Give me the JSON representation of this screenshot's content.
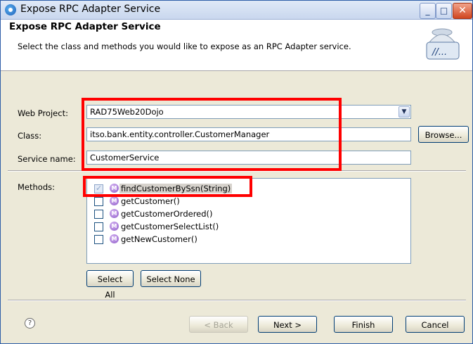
{
  "window": {
    "title": "Expose RPC Adapter Service",
    "minimize_label": "_",
    "maximize_label": "□",
    "close_label": "✕"
  },
  "banner": {
    "title": "Expose RPC Adapter Service",
    "description": "Select the class and methods you would like to expose as an RPC Adapter service.",
    "art_text": "//..."
  },
  "form": {
    "web_project_label": "Web Project:",
    "web_project_value": "RAD75Web20Dojo",
    "class_label": "Class:",
    "class_value": "itso.bank.entity.controller.CustomerManager",
    "browse_label": "Browse...",
    "service_name_label": "Service name:",
    "service_name_value": "CustomerService",
    "methods_label": "Methods:"
  },
  "methods": [
    {
      "name": "findCustomerBySsn(String)",
      "checked": true,
      "selected": true
    },
    {
      "name": "getCustomer()",
      "checked": false,
      "selected": false
    },
    {
      "name": "getCustomerOrdered()",
      "checked": false,
      "selected": false
    },
    {
      "name": "getCustomerSelectList()",
      "checked": false,
      "selected": false
    },
    {
      "name": "getNewCustomer()",
      "checked": false,
      "selected": false
    }
  ],
  "method_icon_letter": "M",
  "method_buttons": {
    "select_all": "Select All",
    "select_none": "Select None"
  },
  "footer": {
    "help_label": "?",
    "back_label": "< Back",
    "next_label": "Next >",
    "finish_label": "Finish",
    "cancel_label": "Cancel"
  },
  "colors": {
    "highlight_box": "#ff0000",
    "titlebar": "#c9d7ee",
    "dialog_bg": "#ece9d8"
  },
  "icons": {
    "title": "rpc-service-icon",
    "banner": "service-bell-icon",
    "method": "method-icon",
    "help": "help-icon",
    "combo": "chevron-down-icon"
  }
}
